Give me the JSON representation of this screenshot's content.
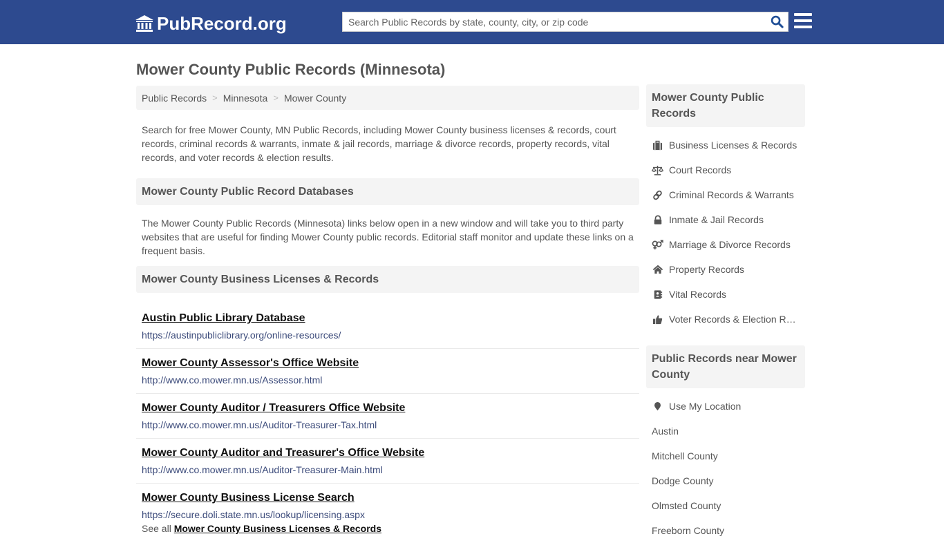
{
  "header": {
    "logo_text": "PubRecord.org",
    "search_placeholder": "Search Public Records by state, county, city, or zip code",
    "search_value": "",
    "colors": {
      "bar": "#2d4a8f",
      "search_icon": "#1f4e96"
    }
  },
  "page": {
    "title": "Mower County Public Records (Minnesota)"
  },
  "breadcrumb": {
    "items": [
      "Public Records",
      "Minnesota",
      "Mower County"
    ],
    "separator": ">"
  },
  "intro": "Search for free Mower County, MN Public Records, including Mower County business licenses & records, court records, criminal records & warrants, inmate & jail records, marriage & divorce records, property records, vital records, and voter records & election results.",
  "databases": {
    "heading": "Mower County Public Record Databases",
    "description": "The Mower County Public Records (Minnesota) links below open in a new window and will take you to third party websites that are useful for finding Mower County public records. Editorial staff monitor and update these links on a frequent basis."
  },
  "business": {
    "heading": "Mower County Business Licenses & Records",
    "links": [
      {
        "title": "Austin Public Library Database",
        "url": "https://austinpubliclibrary.org/online-resources/"
      },
      {
        "title": "Mower County Assessor's Office Website",
        "url": "http://www.co.mower.mn.us/Assessor.html"
      },
      {
        "title": "Mower County Auditor / Treasurers Office Website",
        "url": "http://www.co.mower.mn.us/Auditor-Treasurer-Tax.html"
      },
      {
        "title": "Mower County Auditor and Treasurer's Office Website",
        "url": "http://www.co.mower.mn.us/Auditor-Treasurer-Main.html"
      },
      {
        "title": "Mower County Business License Search",
        "url": "https://secure.doli.state.mn.us/lookup/licensing.aspx"
      }
    ],
    "see_all_prefix": "See all",
    "see_all_link": "Mower County Business Licenses & Records"
  },
  "sidebar": {
    "records_heading": "Mower County Public Records",
    "records": [
      {
        "label": "Business Licenses & Records",
        "icon": "briefcase-icon"
      },
      {
        "label": "Court Records",
        "icon": "balance-scale-icon"
      },
      {
        "label": "Criminal Records & Warrants",
        "icon": "link-icon"
      },
      {
        "label": "Inmate & Jail Records",
        "icon": "lock-icon"
      },
      {
        "label": "Marriage & Divorce Records",
        "icon": "venus-mars-icon"
      },
      {
        "label": "Property Records",
        "icon": "home-icon"
      },
      {
        "label": "Vital Records",
        "icon": "address-book-icon"
      },
      {
        "label": "Voter Records & Election Results",
        "icon": "thumbs-up-icon"
      }
    ],
    "near_heading": "Public Records near Mower County",
    "use_location": "Use My Location",
    "near": [
      "Austin",
      "Mitchell County",
      "Dodge County",
      "Olmsted County",
      "Freeborn County"
    ]
  }
}
